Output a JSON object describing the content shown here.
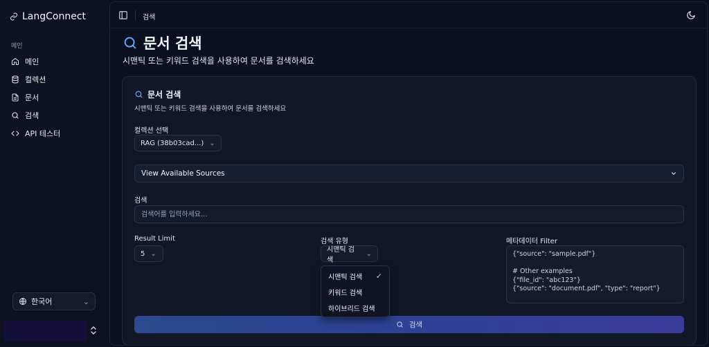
{
  "sidebar": {
    "brand": "LangConnect",
    "group_label": "메인",
    "items": [
      {
        "label": "메인",
        "icon": "home-icon"
      },
      {
        "label": "컬렉션",
        "icon": "database-icon"
      },
      {
        "label": "문서",
        "icon": "file-icon"
      },
      {
        "label": "검색",
        "icon": "search-icon"
      },
      {
        "label": "API 테스터",
        "icon": "code-icon"
      }
    ],
    "language": "한국어"
  },
  "topbar": {
    "breadcrumb": "검색"
  },
  "page": {
    "title": "문서 검색",
    "subtitle": "시맨틱 또는 키워드 검색을 사용하여 문서를 검색하세요"
  },
  "card": {
    "title": "문서 검색",
    "subtitle": "시맨틱 또는 키워드 검색을 사용하여 문서를 검색하세요",
    "collection_label": "컬렉션 선택",
    "collection_value": "RAG (38b03cad...)",
    "sources_label": "View Available Sources",
    "search_label": "검색",
    "search_placeholder": "검색어를 입력하세요...",
    "limit_label": "Result Limit",
    "limit_value": "5",
    "search_type_label": "검색 유형",
    "search_type_value": "시맨틱 검색",
    "search_type_options": [
      "시맨틱 검색",
      "키워드 검색",
      "하이브리드 검색"
    ],
    "metadata_label": "메타데이터 Filter",
    "metadata_value": "{\"source\": \"sample.pdf\"}\n\n# Other examples\n{\"file_id\": \"abc123\"}\n{\"source\": \"document.pdf\", \"type\": \"report\"}",
    "submit_label": "검색"
  },
  "colors": {
    "accent": "#60a5fa",
    "button_gradient_start": "#2b4a8f",
    "button_gradient_end": "#3a3c9a"
  }
}
